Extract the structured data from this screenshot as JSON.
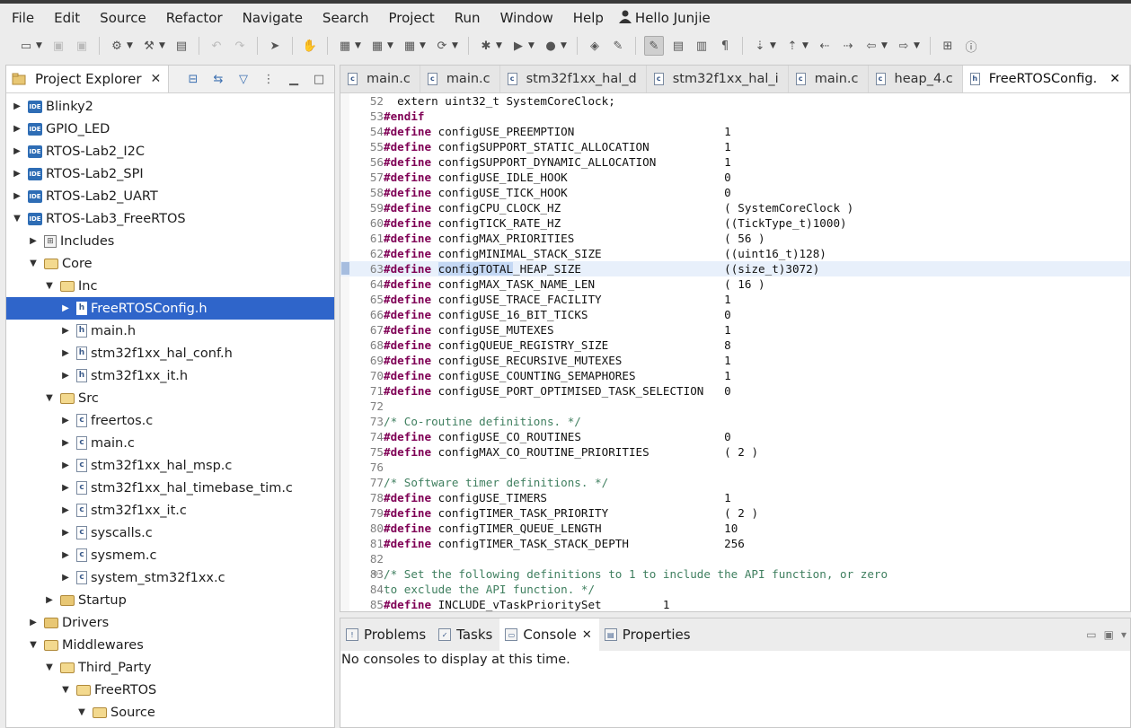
{
  "menu": {
    "items": [
      "File",
      "Edit",
      "Source",
      "Refactor",
      "Navigate",
      "Search",
      "Project",
      "Run",
      "Window",
      "Help"
    ],
    "user_label": "Hello Junjie"
  },
  "project_explorer": {
    "title": "Project Explorer",
    "tree": [
      {
        "label": "Blinky2",
        "icon": "ide-project-icon",
        "level": 0,
        "expanded": false
      },
      {
        "label": "GPIO_LED",
        "icon": "ide-project-icon",
        "level": 0,
        "expanded": false
      },
      {
        "label": "RTOS-Lab2_I2C",
        "icon": "ide-project-icon",
        "level": 0,
        "expanded": false
      },
      {
        "label": "RTOS-Lab2_SPI",
        "icon": "ide-project-icon",
        "level": 0,
        "expanded": false
      },
      {
        "label": "RTOS-Lab2_UART",
        "icon": "ide-project-icon",
        "level": 0,
        "expanded": false
      },
      {
        "label": "RTOS-Lab3_FreeRTOS",
        "icon": "ide-project-icon",
        "level": 0,
        "expanded": true
      },
      {
        "label": "Includes",
        "icon": "includes-icon",
        "level": 1,
        "expanded": false
      },
      {
        "label": "Core",
        "icon": "folder-icon",
        "level": 1,
        "expanded": true
      },
      {
        "label": "Inc",
        "icon": "folder-icon",
        "level": 2,
        "expanded": true
      },
      {
        "label": "FreeRTOSConfig.h",
        "icon": "header-file-icon",
        "level": 3,
        "expanded": false,
        "selected": true
      },
      {
        "label": "main.h",
        "icon": "header-file-icon",
        "level": 3,
        "expanded": false
      },
      {
        "label": "stm32f1xx_hal_conf.h",
        "icon": "header-file-icon",
        "level": 3,
        "expanded": false
      },
      {
        "label": "stm32f1xx_it.h",
        "icon": "header-file-icon",
        "level": 3,
        "expanded": false
      },
      {
        "label": "Src",
        "icon": "folder-icon",
        "level": 2,
        "expanded": true
      },
      {
        "label": "freertos.c",
        "icon": "c-file-icon",
        "level": 3,
        "expanded": false
      },
      {
        "label": "main.c",
        "icon": "c-file-icon",
        "level": 3,
        "expanded": false
      },
      {
        "label": "stm32f1xx_hal_msp.c",
        "icon": "c-file-icon",
        "level": 3,
        "expanded": false
      },
      {
        "label": "stm32f1xx_hal_timebase_tim.c",
        "icon": "c-file-icon",
        "level": 3,
        "expanded": false
      },
      {
        "label": "stm32f1xx_it.c",
        "icon": "c-file-icon",
        "level": 3,
        "expanded": false
      },
      {
        "label": "syscalls.c",
        "icon": "c-file-icon",
        "level": 3,
        "expanded": false
      },
      {
        "label": "sysmem.c",
        "icon": "c-file-icon",
        "level": 3,
        "expanded": false
      },
      {
        "label": "system_stm32f1xx.c",
        "icon": "c-file-icon",
        "level": 3,
        "expanded": false
      },
      {
        "label": "Startup",
        "icon": "folder-icon",
        "level": 2,
        "expanded": false
      },
      {
        "label": "Drivers",
        "icon": "folder-icon",
        "level": 1,
        "expanded": false
      },
      {
        "label": "Middlewares",
        "icon": "folder-icon",
        "level": 1,
        "expanded": true
      },
      {
        "label": "Third_Party",
        "icon": "folder-icon",
        "level": 2,
        "expanded": true
      },
      {
        "label": "FreeRTOS",
        "icon": "folder-icon",
        "level": 3,
        "expanded": true
      },
      {
        "label": "Source",
        "icon": "folder-icon",
        "level": 4,
        "expanded": true
      }
    ]
  },
  "editor": {
    "tabs": [
      {
        "label": "main.c",
        "icon": "c-file-icon"
      },
      {
        "label": "main.c",
        "icon": "c-file-icon"
      },
      {
        "label": "stm32f1xx_hal_d",
        "icon": "c-file-icon"
      },
      {
        "label": "stm32f1xx_hal_i",
        "icon": "c-file-icon"
      },
      {
        "label": "main.c",
        "icon": "c-file-icon"
      },
      {
        "label": "heap_4.c",
        "icon": "c-file-icon"
      },
      {
        "label": "FreeRTOSConfig.",
        "icon": "header-file-icon",
        "active": true
      }
    ],
    "lines": [
      {
        "n": "52",
        "pre": "  extern uint32_t SystemCoreClock;",
        "kw": "",
        "name": "",
        "value": ""
      },
      {
        "n": "53",
        "kwonly": "#endif"
      },
      {
        "n": "54",
        "kw": "#define",
        "name": "configUSE_PREEMPTION",
        "value": "1"
      },
      {
        "n": "55",
        "kw": "#define",
        "name": "configSUPPORT_STATIC_ALLOCATION",
        "value": "1"
      },
      {
        "n": "56",
        "kw": "#define",
        "name": "configSUPPORT_DYNAMIC_ALLOCATION",
        "value": "1"
      },
      {
        "n": "57",
        "kw": "#define",
        "name": "configUSE_IDLE_HOOK",
        "value": "0"
      },
      {
        "n": "58",
        "kw": "#define",
        "name": "configUSE_TICK_HOOK",
        "value": "0"
      },
      {
        "n": "59",
        "kw": "#define",
        "name": "configCPU_CLOCK_HZ",
        "value": "( SystemCoreClock )"
      },
      {
        "n": "60",
        "kw": "#define",
        "name": "configTICK_RATE_HZ",
        "value": "((TickType_t)1000)"
      },
      {
        "n": "61",
        "kw": "#define",
        "name": "configMAX_PRIORITIES",
        "value": "( 56 )"
      },
      {
        "n": "62",
        "kw": "#define",
        "name": "configMINIMAL_STACK_SIZE",
        "value": "((uint16_t)128)"
      },
      {
        "n": "63",
        "kw": "#define",
        "name": "configTOTAL_HEAP_SIZE",
        "value": "((size_t)3072)",
        "current": true,
        "selected_part": "configTOTAL"
      },
      {
        "n": "64",
        "kw": "#define",
        "name": "configMAX_TASK_NAME_LEN",
        "value": "( 16 )"
      },
      {
        "n": "65",
        "kw": "#define",
        "name": "configUSE_TRACE_FACILITY",
        "value": "1"
      },
      {
        "n": "66",
        "kw": "#define",
        "name": "configUSE_16_BIT_TICKS",
        "value": "0"
      },
      {
        "n": "67",
        "kw": "#define",
        "name": "configUSE_MUTEXES",
        "value": "1"
      },
      {
        "n": "68",
        "kw": "#define",
        "name": "configQUEUE_REGISTRY_SIZE",
        "value": "8"
      },
      {
        "n": "69",
        "kw": "#define",
        "name": "configUSE_RECURSIVE_MUTEXES",
        "value": "1"
      },
      {
        "n": "70",
        "kw": "#define",
        "name": "configUSE_COUNTING_SEMAPHORES",
        "value": "1"
      },
      {
        "n": "71",
        "kw": "#define",
        "name": "configUSE_PORT_OPTIMISED_TASK_SELECTION",
        "value": "0"
      },
      {
        "n": "72"
      },
      {
        "n": "73",
        "comment": "/* Co-routine definitions. */"
      },
      {
        "n": "74",
        "kw": "#define",
        "name": "configUSE_CO_ROUTINES",
        "value": "0"
      },
      {
        "n": "75",
        "kw": "#define",
        "name": "configMAX_CO_ROUTINE_PRIORITIES",
        "value": "( 2 )"
      },
      {
        "n": "76"
      },
      {
        "n": "77",
        "comment": "/* Software timer definitions. */"
      },
      {
        "n": "78",
        "kw": "#define",
        "name": "configUSE_TIMERS",
        "value": "1"
      },
      {
        "n": "79",
        "kw": "#define",
        "name": "configTIMER_TASK_PRIORITY",
        "value": "( 2 )"
      },
      {
        "n": "80",
        "kw": "#define",
        "name": "configTIMER_QUEUE_LENGTH",
        "value": "10"
      },
      {
        "n": "81",
        "kw": "#define",
        "name": "configTIMER_TASK_STACK_DEPTH",
        "value": "256"
      },
      {
        "n": "82"
      },
      {
        "n": "83",
        "comment": "/* Set the following definitions to 1 to include the API function, or zero",
        "fold": true
      },
      {
        "n": "84",
        "comment": "to exclude the API function. */"
      },
      {
        "n": "85",
        "kw": "#define",
        "name": "INCLUDE_vTaskPrioritySet",
        "value": "1",
        "short": true
      }
    ]
  },
  "bottom_panel": {
    "tabs": [
      {
        "label": "Problems",
        "icon": "problems-icon"
      },
      {
        "label": "Tasks",
        "icon": "tasks-icon"
      },
      {
        "label": "Console",
        "icon": "console-icon",
        "active": true
      },
      {
        "label": "Properties",
        "icon": "properties-icon"
      }
    ],
    "message": "No consoles to display at this time."
  },
  "colors": {
    "selection": "#2f65ca",
    "keyword": "#7f0055",
    "comment": "#3f7f5f"
  }
}
